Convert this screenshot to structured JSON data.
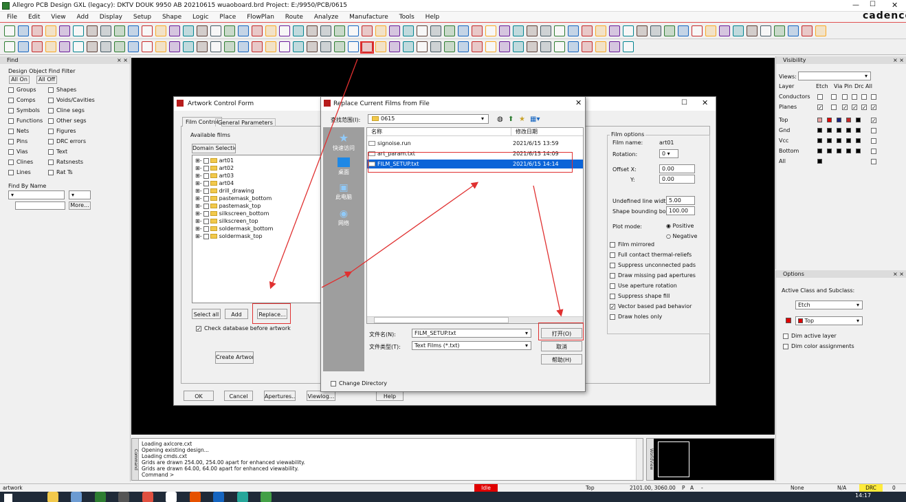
{
  "app": {
    "title": "Allegro PCB Design GXL (legacy): DKTV DOUK 9950 AB 20210615 wuaoboard.brd Project: E:/9950/PCB/0615",
    "brand": "cadence",
    "menu": [
      "File",
      "Edit",
      "View",
      "Add",
      "Display",
      "Setup",
      "Shape",
      "Logic",
      "Place",
      "FlowPlan",
      "Route",
      "Analyze",
      "Manufacture",
      "Tools",
      "Help"
    ]
  },
  "find_panel": {
    "title": "Find",
    "group_title": "Design Object Find Filter",
    "all_on": "All On",
    "all_off": "All Off",
    "filters_left": [
      "Groups",
      "Comps",
      "Symbols",
      "Functions",
      "Nets",
      "Pins",
      "Vias",
      "Clines",
      "Lines"
    ],
    "filters_right": [
      "Shapes",
      "Voids/Cavities",
      "Cline segs",
      "Other segs",
      "Figures",
      "DRC errors",
      "Text",
      "Ratsnests",
      "Rat Ts"
    ],
    "find_by_name": "Find By Name",
    "more_button": "More..."
  },
  "artwork_dialog": {
    "title": "Artwork Control Form",
    "tabs": [
      "Film Control",
      "General Parameters"
    ],
    "available_films": "Available films",
    "domain_selection": "Domain Selection",
    "films": [
      "art01",
      "art02",
      "art03",
      "art04",
      "drill_drawing",
      "pastemask_bottom",
      "pastemask_top",
      "silkscreen_bottom",
      "silkscreen_top",
      "soldermask_bottom",
      "soldermask_top"
    ],
    "select_all": "Select all",
    "add": "Add",
    "replace": "Replace...",
    "check_db": "Check database before artwork",
    "create_artwork": "Create Artwork",
    "film_options": "Film options",
    "film_name_label": "Film name:",
    "film_name_value": "art01",
    "rotation_label": "Rotation:",
    "rotation_value": "0",
    "offset_x_label": "Offset   X:",
    "offset_x_value": "0.00",
    "offset_y_label": "Y:",
    "offset_y_value": "0.00",
    "undefined_width_label": "Undefined line width:",
    "undefined_width_value": "5.00",
    "shape_bounding_label": "Shape bounding box:",
    "shape_bounding_value": "100.00",
    "plot_mode_label": "Plot mode:",
    "positive": "Positive",
    "negative": "Negative",
    "options": [
      "Film mirrored",
      "Full contact thermal-reliefs",
      "Suppress unconnected pads",
      "Draw missing pad apertures",
      "Use aperture rotation",
      "Suppress shape fill",
      "Vector based pad behavior",
      "Draw holes only"
    ],
    "options_checked": [
      false,
      false,
      false,
      false,
      false,
      false,
      true,
      false
    ],
    "buttons": [
      "OK",
      "Cancel",
      "Apertures...",
      "Viewlog...",
      "Help"
    ]
  },
  "file_dialog": {
    "title": "Replace Current Films from File",
    "lookin_label": "查找范围(I):",
    "lookin_value": "0615",
    "places": [
      "快速访问",
      "桌面",
      "此电脑",
      "网络"
    ],
    "col_name": "名称",
    "col_date": "修改日期",
    "files": [
      {
        "name": "signoise.run",
        "date": "2021/6/15 13:59"
      },
      {
        "name": "art_param.txt",
        "date": "2021/6/15 14:09"
      },
      {
        "name": "FILM_SETUP.txt",
        "date": "2021/6/15 14:14"
      }
    ],
    "filename_label": "文件名(N):",
    "filename_value": "FILM_SETUP.txt",
    "filetype_label": "文件类型(T):",
    "filetype_value": "Text Films (*.txt)",
    "open": "打开(O)",
    "cancel": "取消",
    "help": "帮助(H)",
    "change_dir": "Change Directory"
  },
  "visibility": {
    "title": "Visibility",
    "views_label": "Views:",
    "headers": [
      "Layer",
      "Etch",
      "Via",
      "Pin",
      "Drc",
      "All"
    ],
    "rows": [
      "Conductors",
      "Planes",
      "Top",
      "Gnd",
      "Vcc",
      "Bottom",
      "All"
    ]
  },
  "options_panel": {
    "title": "Options",
    "active_label": "Active Class and Subclass:",
    "class_value": "Etch",
    "subclass_value": "Top",
    "dim_active": "Dim active layer",
    "dim_color": "Dim color assignments"
  },
  "console": {
    "lines": [
      "Loading axlcore.cxt",
      "Opening existing design...",
      "Loading cmds.cxt",
      "Grids are drawn 254.00, 254.00 apart for enhanced viewability.",
      "Grids are drawn 64.00, 64.00 apart for enhanced viewability.",
      "Command >"
    ],
    "side_label": "Command"
  },
  "worldview": {
    "side_label": "WorldView"
  },
  "status": {
    "left": "artwork",
    "idle": "Idle",
    "layer": "Top",
    "coords": "2101.00, 3060.00",
    "p_marker": "P",
    "a_marker": "A",
    "dash": "-",
    "none": "None",
    "na": "N/A",
    "drc": "DRC",
    "zero": "0"
  },
  "taskbar": {
    "time": "14:17"
  },
  "colors": {
    "accent_red": "#e03030",
    "select_blue": "#0a64d8",
    "canvas": "#000000"
  }
}
